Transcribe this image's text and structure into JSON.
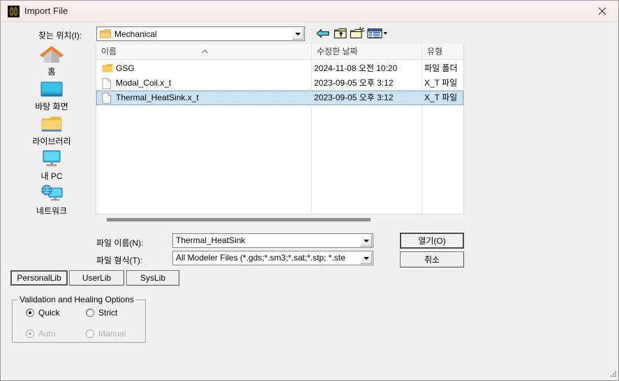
{
  "window": {
    "title": "Import File",
    "app_icon": "ansys-app-icon",
    "close_label": "×"
  },
  "lookin": {
    "label": "찾는 위치(I):",
    "value": "Mechanical",
    "icon": "folder-icon"
  },
  "toolbar": {
    "back": "back-arrow-icon",
    "up": "up-one-level-icon",
    "new_folder": "new-folder-icon",
    "views": "views-menu-icon"
  },
  "places": [
    {
      "label": "홈",
      "icon": "home-icon"
    },
    {
      "label": "바탕 화면",
      "icon": "desktop-icon"
    },
    {
      "label": "라이브러리",
      "icon": "library-folder-icon"
    },
    {
      "label": "내 PC",
      "icon": "this-pc-icon"
    },
    {
      "label": "네트워크",
      "icon": "network-icon"
    }
  ],
  "filelist": {
    "columns": [
      "이름",
      "수정한 날짜",
      "유형"
    ],
    "sort_column": "이름",
    "sort_direction": "ascending",
    "rows": [
      {
        "name": "GSG",
        "date": "2024-11-08 오전 10:20",
        "type": "파일 폴더",
        "icon": "folder-icon",
        "selected": false
      },
      {
        "name": "Modal_Coil.x_t",
        "date": "2023-09-05 오후 3:12",
        "type": "X_T 파일",
        "icon": "file-icon",
        "selected": false
      },
      {
        "name": "Thermal_HeatSink.x_t",
        "date": "2023-09-05 오후 3:12",
        "type": "X_T 파일",
        "icon": "file-icon",
        "selected": true
      }
    ]
  },
  "fields": {
    "filename_label": "파일 이름(N):",
    "filename_value": "Thermal_HeatSink",
    "filetype_label": "파일 형식(T):",
    "filetype_value": "All Modeler Files (*.gds;*.sm3;*.sat;*.stp; *.ste"
  },
  "actions": {
    "open": "열기(O)",
    "cancel": "취소"
  },
  "libraries": [
    {
      "label": "PersonalLib"
    },
    {
      "label": "UserLib"
    },
    {
      "label": "SysLib"
    }
  ],
  "validation": {
    "title": "Validation and Healing Options",
    "options": [
      {
        "label": "Quick",
        "checked": true,
        "disabled": false
      },
      {
        "label": "Strict",
        "checked": false,
        "disabled": false
      },
      {
        "label": "Auto",
        "checked": true,
        "disabled": true
      },
      {
        "label": "Manual",
        "checked": false,
        "disabled": true
      }
    ]
  },
  "colors": {
    "selection": "#cce4f7",
    "dialog_bg": "#f0f0f0",
    "titlebar_bg": "#f7eeec",
    "folder": "#fdd36a"
  }
}
